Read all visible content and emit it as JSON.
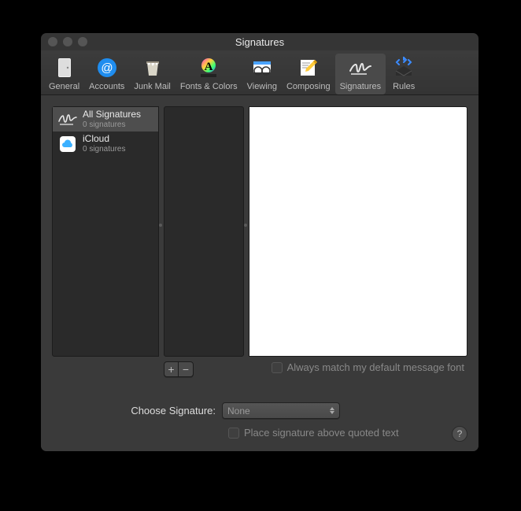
{
  "window": {
    "title": "Signatures"
  },
  "toolbar": {
    "items": [
      {
        "label": "General"
      },
      {
        "label": "Accounts"
      },
      {
        "label": "Junk Mail"
      },
      {
        "label": "Fonts & Colors"
      },
      {
        "label": "Viewing"
      },
      {
        "label": "Composing"
      },
      {
        "label": "Signatures"
      },
      {
        "label": "Rules"
      }
    ]
  },
  "accounts": [
    {
      "name": "All Signatures",
      "sub": "0 signatures"
    },
    {
      "name": "iCloud",
      "sub": "0 signatures"
    }
  ],
  "controls": {
    "plus": "+",
    "minus": "−",
    "matchFont": "Always match my default message font",
    "chooseLabel": "Choose Signature:",
    "chooseValue": "None",
    "placeAbove": "Place signature above quoted text",
    "help": "?"
  }
}
